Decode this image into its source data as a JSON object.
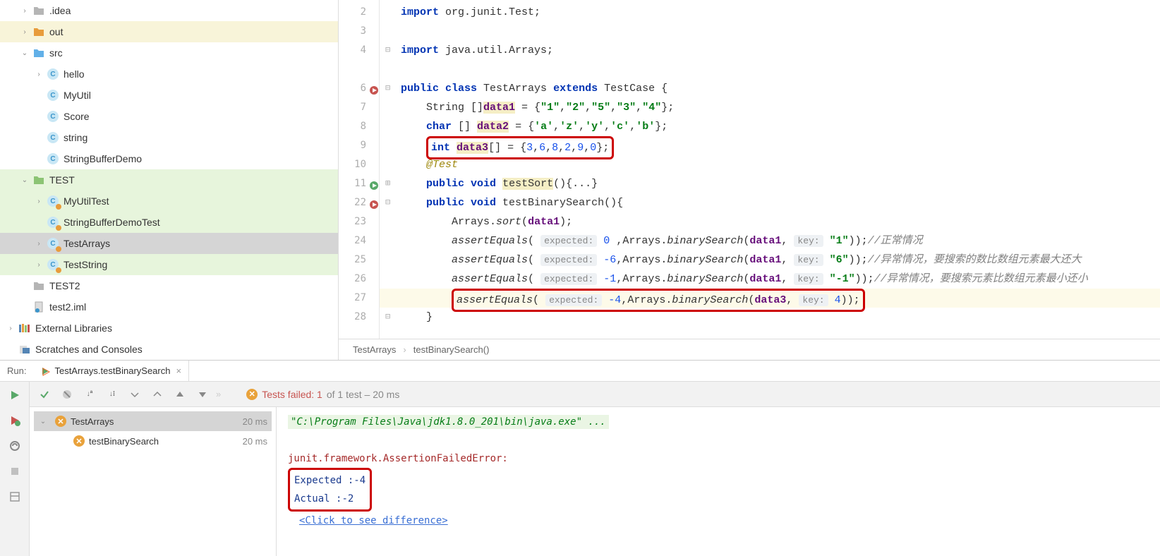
{
  "project_tree": {
    "items": [
      {
        "label": ".idea",
        "icon": "folder-gray",
        "chev": "right",
        "indent": 1
      },
      {
        "label": "out",
        "icon": "folder-orange",
        "chev": "right",
        "indent": 1,
        "hl": true
      },
      {
        "label": "src",
        "icon": "folder-blue",
        "chev": "down",
        "indent": 1
      },
      {
        "label": "hello",
        "icon": "class",
        "chev": "right",
        "indent": 2
      },
      {
        "label": "MyUtil",
        "icon": "class",
        "indent": 2
      },
      {
        "label": "Score",
        "icon": "class",
        "indent": 2
      },
      {
        "label": "string",
        "icon": "class",
        "indent": 2
      },
      {
        "label": "StringBufferDemo",
        "icon": "class",
        "indent": 2
      },
      {
        "label": "TEST",
        "icon": "folder-green",
        "chev": "down",
        "indent": 1,
        "hlg": true
      },
      {
        "label": "MyUtilTest",
        "icon": "class-test",
        "chev": "right",
        "indent": 2,
        "hlg": true
      },
      {
        "label": "StringBufferDemoTest",
        "icon": "class-test",
        "indent": 2,
        "hlg": true
      },
      {
        "label": "TestArrays",
        "icon": "class-test",
        "chev": "right",
        "indent": 2,
        "sel": true
      },
      {
        "label": "TestString",
        "icon": "class-test",
        "chev": "right",
        "indent": 2,
        "hlg": true
      },
      {
        "label": "TEST2",
        "icon": "folder-gray",
        "indent": 1
      },
      {
        "label": "test2.iml",
        "icon": "file",
        "indent": 1
      },
      {
        "label": "External Libraries",
        "icon": "lib",
        "chev": "right",
        "indent": 0
      },
      {
        "label": "Scratches and Consoles",
        "icon": "scratch",
        "indent": 0
      }
    ]
  },
  "editor": {
    "lines": [
      {
        "n": 2,
        "html": "<span class='kw'>import</span> org.junit.Test;"
      },
      {
        "n": 3,
        "html": ""
      },
      {
        "n": 4,
        "html": "<span class='kw'>import</span> java.util.Arrays;",
        "fold": "−"
      },
      {
        "n": "",
        "html": ""
      },
      {
        "n": 6,
        "html": "<span class='kw'>public class</span> TestArrays <span class='kw'>extends</span> TestCase {",
        "mark": "red",
        "fold": "−"
      },
      {
        "n": 7,
        "html": "    String []<span class='ident hl-yellow'>data1</span> = {<span class='str'>\"1\"</span>,<span class='str'>\"2\"</span>,<span class='str'>\"5\"</span>,<span class='str'>\"3\"</span>,<span class='str'>\"4\"</span>};"
      },
      {
        "n": 8,
        "html": "    <span class='kw'>char</span> [] <span class='ident hl-yellow'>data2</span> = {<span class='str'>'a'</span>,<span class='str'>'z'</span>,<span class='str'>'y'</span>,<span class='str'>'c'</span>,<span class='str'>'b'</span>};"
      },
      {
        "n": 9,
        "html": "    <span class='redbox'><span class='kw'>int</span> <span class='ident hl-yellow'>data3</span>[] = {<span class='num'>3</span>,<span class='num'>6</span>,<span class='num'>8</span>,<span class='num'>2</span>,<span class='num'>9</span>,<span class='num'>0</span>};</span>"
      },
      {
        "n": 10,
        "html": "    <span class='ann'>@Test</span>"
      },
      {
        "n": 11,
        "html": "    <span class='kw'>public void</span> <span class='hl-yellow'>testSort</span>(){...}",
        "mark": "green",
        "fold": "+"
      },
      {
        "n": 22,
        "html": "    <span class='kw'>public void</span> testBinarySearch(){",
        "mark": "red",
        "fold": "−"
      },
      {
        "n": 23,
        "html": "        Arrays.<span class='fn'>sort</span>(<span class='ident'>data1</span>);"
      },
      {
        "n": 24,
        "html": "        <span class='fn'>assertEquals</span>( <span class='hint'>expected:</span> <span class='num'>0</span> ,Arrays.<span class='fn'>binarySearch</span>(<span class='ident'>data1</span>, <span class='hint'>key:</span> <span class='str'>\"1\"</span>));<span class='com'>//正常情况</span>"
      },
      {
        "n": 25,
        "html": "        <span class='fn'>assertEquals</span>( <span class='hint'>expected:</span> <span class='num'>-6</span>,Arrays.<span class='fn'>binarySearch</span>(<span class='ident'>data1</span>, <span class='hint'>key:</span> <span class='str'>\"6\"</span>));<span class='com'>//异常情况，要搜索的数比数组元素最大还大</span>"
      },
      {
        "n": 26,
        "html": "        <span class='fn'>assertEquals</span>( <span class='hint'>expected:</span> <span class='num'>-1</span>,Arrays.<span class='fn'>binarySearch</span>(<span class='ident'>data1</span>, <span class='hint'>key:</span> <span class='str'>\"-1\"</span>));<span class='com'>//异常情况，要搜索元素比数组元素最小还小</span>"
      },
      {
        "n": 27,
        "html": "        <span class='redbox'><span class='fn'>assertEquals</span>( <span class='hint'>expected:</span> <span class='num'>-4</span>,Arrays.<span class='fn'>binarySearch</span>(<span class='ident'>data3</span>, <span class='hint'>key:</span> <span class='num'>4</span>));</span>",
        "cur": true
      },
      {
        "n": 28,
        "html": "    }",
        "fold": "−"
      }
    ],
    "breadcrumb": {
      "class": "TestArrays",
      "method": "testBinarySearch()"
    }
  },
  "run_panel": {
    "label": "Run:",
    "tab_name": "TestArrays.testBinarySearch",
    "status_fail": "Tests failed: 1",
    "status_total": " of 1 test – 20 ms",
    "tests": [
      {
        "name": "TestArrays",
        "time": "20 ms",
        "root": true
      },
      {
        "name": "testBinarySearch",
        "time": "20 ms"
      }
    ],
    "console": {
      "cmd": "\"C:\\Program Files\\Java\\jdk1.8.0_201\\bin\\java.exe\" ...",
      "err": "junit.framework.AssertionFailedError:",
      "expected_label": "Expected :",
      "expected_val": "-4",
      "actual_label": "Actual   :",
      "actual_val": "-2",
      "link": "<Click to see difference>"
    }
  }
}
